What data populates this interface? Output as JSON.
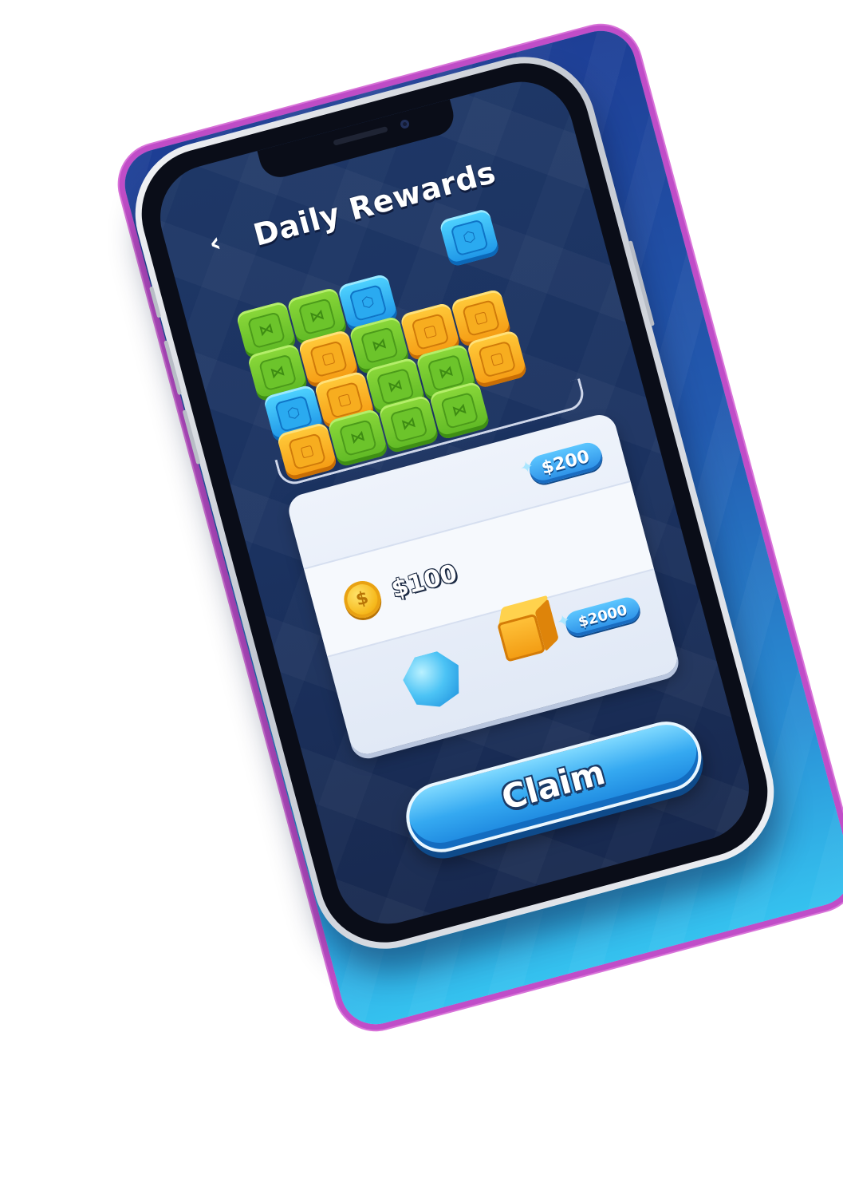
{
  "screen": {
    "title": "Daily Rewards",
    "back_icon": "chevron-left-icon",
    "back_glyph": "‹"
  },
  "board": {
    "rows": [
      [
        "blue"
      ],
      [
        "green",
        "green",
        "blue"
      ],
      [
        "green",
        "orange",
        "green",
        "orange",
        "orange"
      ],
      [
        "blue",
        "orange",
        "green",
        "green",
        "orange"
      ],
      [
        "orange",
        "green",
        "green",
        "green"
      ]
    ],
    "colors": {
      "green": "#6cc42b",
      "orange": "#f7ad1f",
      "blue": "#2aaaf0"
    }
  },
  "rewards": {
    "coin_amount": "$100",
    "coin_icon": "coin-icon",
    "coin_glyph": "$",
    "bonus_1": "$200",
    "bonus_2": "$2000",
    "gem_icon": "gem-icon",
    "cube_icon": "gold-cube-icon"
  },
  "actions": {
    "claim_label": "Claim"
  },
  "colors": {
    "accent": "#2a8ee6",
    "frame_outline": "#c04dc8",
    "screen_bg": "#1e3766"
  }
}
